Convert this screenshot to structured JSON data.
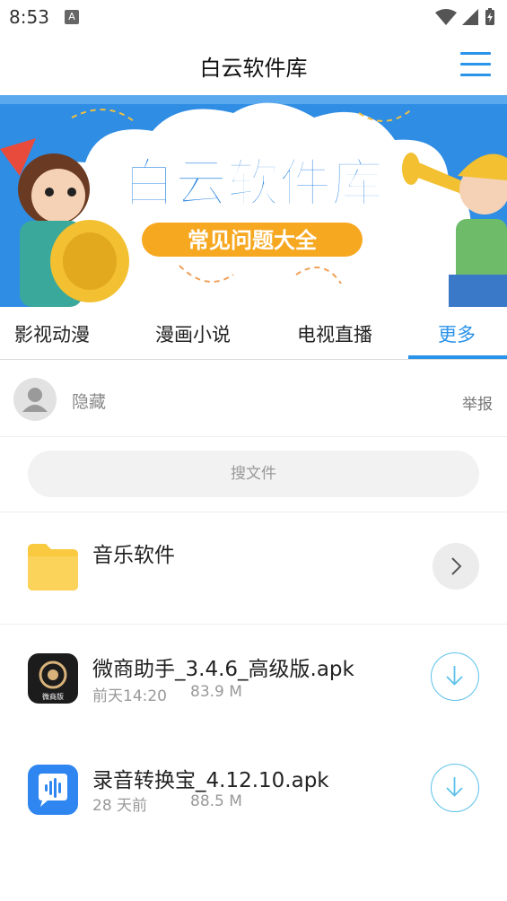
{
  "status_bar": {
    "time": "8:53",
    "badge": "A"
  },
  "header": {
    "title": "白云软件库"
  },
  "banner": {
    "headline": "白云软件库",
    "subtitle": "常见问题大全"
  },
  "tabs": [
    {
      "label": "影视动漫"
    },
    {
      "label": "漫画小说"
    },
    {
      "label": "电视直播"
    },
    {
      "label": "更多"
    }
  ],
  "user": {
    "name": "隐藏",
    "report_label": "举报"
  },
  "search": {
    "placeholder": "搜文件"
  },
  "folder": {
    "name": "音乐软件"
  },
  "files": [
    {
      "name": "微商助手_3.4.6_高级版.apk",
      "time": "前天14:20",
      "size": "83.9 M",
      "icon_text": "微商版"
    },
    {
      "name": "录音转换宝_4.12.10.apk",
      "time": "28 天前",
      "size": "88.5 M"
    }
  ],
  "colors": {
    "accent": "#2a93ea",
    "download_ring": "#5cc1ea",
    "folder": "#f9c940"
  }
}
